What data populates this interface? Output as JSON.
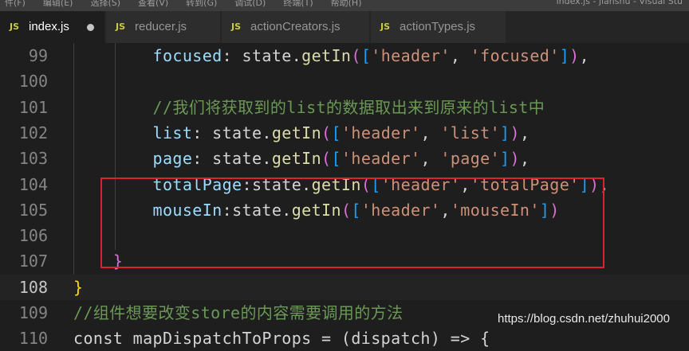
{
  "menubar": {
    "items": [
      "件(F)",
      "编辑(E)",
      "选择(S)",
      "查看(V)",
      "转到(G)",
      "调试(D)",
      "终端(T)",
      "帮助(H)"
    ],
    "window_title": "index.js - jianshu - Visual Stu"
  },
  "tabs": [
    {
      "label": "index.js",
      "icon": "JS",
      "active": true,
      "dirty": true
    },
    {
      "label": "reducer.js",
      "icon": "JS",
      "active": false,
      "dirty": false
    },
    {
      "label": "actionCreators.js",
      "icon": "JS",
      "active": false,
      "dirty": false
    },
    {
      "label": "actionTypes.js",
      "icon": "JS",
      "active": false,
      "dirty": false
    }
  ],
  "editor": {
    "lines": [
      {
        "number": "99",
        "tokens": [
          {
            "t": "        ",
            "c": "ind"
          },
          {
            "t": "focused",
            "c": "prop"
          },
          {
            "t": ": state."
          },
          {
            "t": "getIn",
            "c": "fn"
          },
          {
            "t": "(",
            "c": "br1"
          },
          {
            "t": "[",
            "c": "br2"
          },
          {
            "t": "'header'",
            "c": "str"
          },
          {
            "t": ", "
          },
          {
            "t": "'focused'",
            "c": "str"
          },
          {
            "t": "]",
            "c": "br2"
          },
          {
            "t": ")",
            "c": "br1"
          },
          {
            "t": ","
          }
        ]
      },
      {
        "number": "100",
        "tokens": []
      },
      {
        "number": "101",
        "tokens": [
          {
            "t": "        ",
            "c": "ind"
          },
          {
            "t": "//我们将获取到的list的数据取出来到原来的list中",
            "c": "comment"
          }
        ]
      },
      {
        "number": "102",
        "tokens": [
          {
            "t": "        ",
            "c": "ind"
          },
          {
            "t": "list",
            "c": "prop"
          },
          {
            "t": ": state."
          },
          {
            "t": "getIn",
            "c": "fn"
          },
          {
            "t": "(",
            "c": "br1"
          },
          {
            "t": "[",
            "c": "br2"
          },
          {
            "t": "'header'",
            "c": "str"
          },
          {
            "t": ", "
          },
          {
            "t": "'list'",
            "c": "str"
          },
          {
            "t": "]",
            "c": "br2"
          },
          {
            "t": ")",
            "c": "br1"
          },
          {
            "t": ","
          }
        ]
      },
      {
        "number": "103",
        "tokens": [
          {
            "t": "        ",
            "c": "ind"
          },
          {
            "t": "page",
            "c": "prop"
          },
          {
            "t": ": state."
          },
          {
            "t": "getIn",
            "c": "fn"
          },
          {
            "t": "(",
            "c": "br1"
          },
          {
            "t": "[",
            "c": "br2"
          },
          {
            "t": "'header'",
            "c": "str"
          },
          {
            "t": ", "
          },
          {
            "t": "'page'",
            "c": "str"
          },
          {
            "t": "]",
            "c": "br2"
          },
          {
            "t": ")",
            "c": "br1"
          },
          {
            "t": ","
          }
        ]
      },
      {
        "number": "104",
        "tokens": [
          {
            "t": "        ",
            "c": "ind"
          },
          {
            "t": "totalPage",
            "c": "prop"
          },
          {
            "t": ":state."
          },
          {
            "t": "getIn",
            "c": "fn"
          },
          {
            "t": "(",
            "c": "br1"
          },
          {
            "t": "[",
            "c": "br2"
          },
          {
            "t": "'header'",
            "c": "str"
          },
          {
            "t": ","
          },
          {
            "t": "'totalPage'",
            "c": "str"
          },
          {
            "t": "]",
            "c": "br2"
          },
          {
            "t": ")",
            "c": "br1"
          },
          {
            "t": ","
          }
        ]
      },
      {
        "number": "105",
        "tokens": [
          {
            "t": "        ",
            "c": "ind"
          },
          {
            "t": "mouseIn",
            "c": "prop"
          },
          {
            "t": ":state."
          },
          {
            "t": "getIn",
            "c": "fn"
          },
          {
            "t": "(",
            "c": "br1"
          },
          {
            "t": "[",
            "c": "br2"
          },
          {
            "t": "'header'",
            "c": "str"
          },
          {
            "t": ","
          },
          {
            "t": "'mouseIn'",
            "c": "str"
          },
          {
            "t": "]",
            "c": "br2"
          },
          {
            "t": ")",
            "c": "br1"
          }
        ]
      },
      {
        "number": "106",
        "tokens": []
      },
      {
        "number": "107",
        "tokens": [
          {
            "t": "    ",
            "c": "ind"
          },
          {
            "t": "}",
            "c": "br1"
          }
        ]
      },
      {
        "number": "108",
        "current": true,
        "tokens": [
          {
            "t": "}",
            "c": "brace-y"
          }
        ]
      },
      {
        "number": "109",
        "tokens": [
          {
            "t": "//组件想要改变store的内容需要调用的方法",
            "c": "comment"
          }
        ]
      },
      {
        "number": "110",
        "tokens": [
          {
            "t": "const mapDispatchToProps = (dispatch) => {"
          }
        ]
      }
    ]
  },
  "watermark": "https://blog.csdn.net/zhuhui2000"
}
